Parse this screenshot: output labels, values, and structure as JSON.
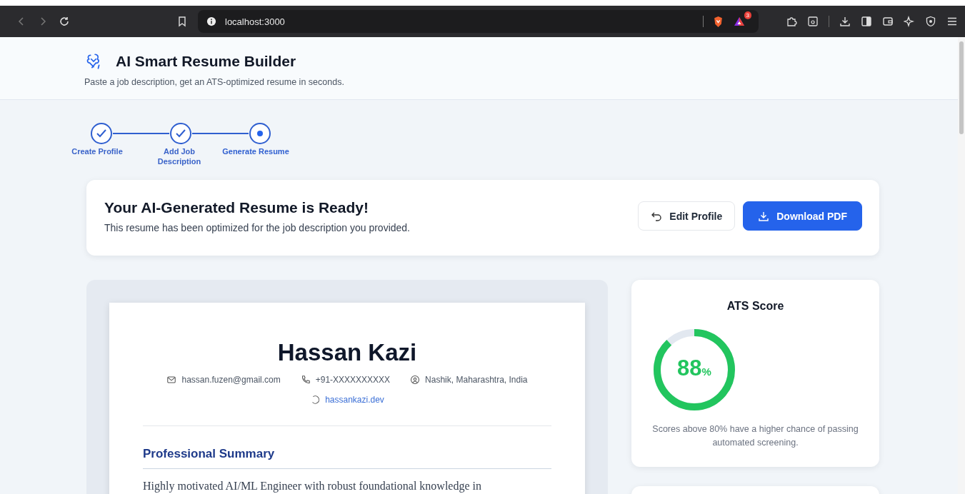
{
  "browser": {
    "url": "localhost:3000",
    "badge": "3"
  },
  "header": {
    "title": "AI Smart Resume Builder",
    "subtitle": "Paste a job description, get an ATS-optimized resume in seconds."
  },
  "steps": [
    {
      "label": "Create Profile",
      "completed": true,
      "selected": false
    },
    {
      "label": "Add Job Description",
      "completed": true,
      "selected": false
    },
    {
      "label": "Generate Resume",
      "completed": false,
      "selected": true
    }
  ],
  "banner": {
    "title": "Your AI-Generated Resume is Ready!",
    "subtitle": "This resume has been optimized for the job description you provided.",
    "buttons": [
      {
        "label": "Edit Profile",
        "kind": "secondary"
      },
      {
        "label": "Download PDF",
        "kind": "primary"
      }
    ]
  },
  "resume": {
    "name": "Hassan Kazi",
    "contacts": [
      {
        "kind": "email",
        "text": "hassan.fuzen@gmail.com"
      },
      {
        "kind": "phone",
        "text": "+91-XXXXXXXXXX"
      },
      {
        "kind": "location",
        "text": "Nashik, Maharashtra, India"
      },
      {
        "kind": "website",
        "text": "hassankazi.dev"
      }
    ],
    "sections": [
      {
        "heading": "Professional Summary",
        "text": "Highly motivated AI/ML Engineer with robust foundational knowledge in"
      }
    ]
  },
  "ats": {
    "title": "ATS Score",
    "score": "88",
    "unit": "%",
    "note": "Scores above 80% have a higher chance of passing automated screening."
  }
}
